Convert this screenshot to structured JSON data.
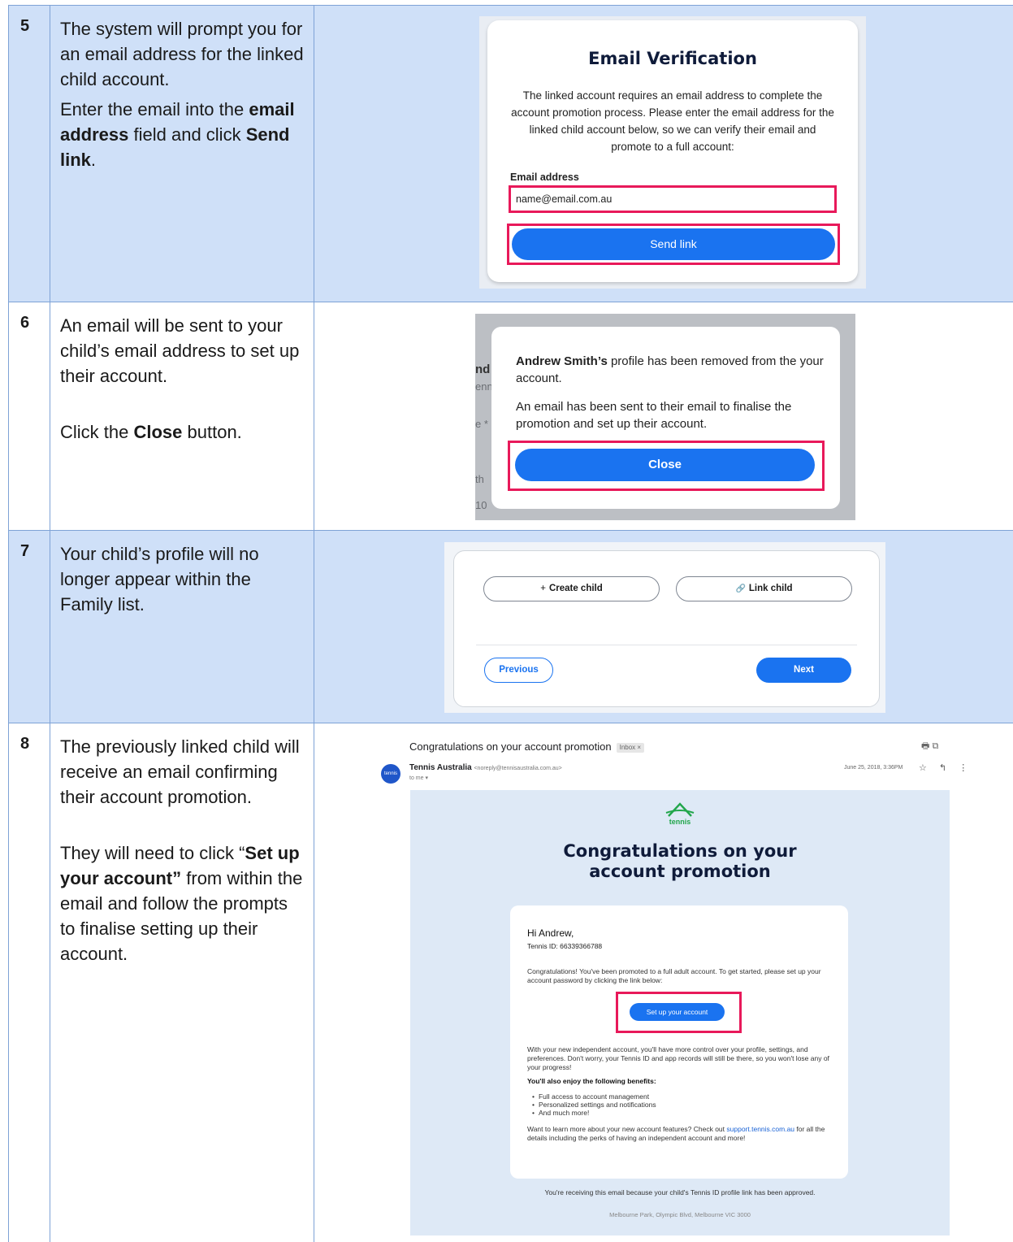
{
  "steps": [
    {
      "number": "5",
      "para1": "The system will prompt you for an email address for the linked child account.",
      "para2": {
        "pre": "Enter the email into the ",
        "bold1": "email address",
        "mid": " field and click ",
        "bold2": "Send link",
        "post": "."
      }
    },
    {
      "number": "6",
      "para1": "An email will be sent to your child’s email address to set up their account.",
      "para2": {
        "pre": "Click the ",
        "bold1": "Close",
        "post": " button."
      }
    },
    {
      "number": "7",
      "para1": "Your child’s profile will no longer appear within the Family list."
    },
    {
      "number": "8",
      "para1": "The previously linked child will receive an email confirming their account promotion.",
      "para2": {
        "pre": "They will need to click “",
        "bold1": "Set up your account”",
        "post": " from within the email and follow the prompts to finalise setting up their account."
      }
    }
  ],
  "verification": {
    "title": "Email Verification",
    "body": "The linked account requires an email address to complete the account promotion process. Please enter the email address for the linked child account below, so we can verify their email and promote to a full account:",
    "field_label": "Email address",
    "field_value": "name@email.com.au",
    "send_label": "Send link"
  },
  "removed_modal": {
    "name": "Andrew Smith’s",
    "line1_rest": " profile has been removed from the your account.",
    "line2": "An email has been sent to their email to finalise the promotion and set up their account.",
    "close_label": "Close",
    "ghost": {
      "a": "nd",
      "b": "enn",
      "c": "e *",
      "d": "th",
      "e": "10"
    }
  },
  "family": {
    "create_icon": "+",
    "create_label": "Create child",
    "link_icon": "🔗",
    "link_label": "Link child",
    "previous_label": "Previous",
    "next_label": "Next"
  },
  "email": {
    "subject": "Congratulations on your account promotion",
    "badge": "Inbox ×",
    "tools": "🖶  ⧉",
    "sender_name": "Tennis Australia",
    "sender_addr": "<noreply@tennisaustralia.com.au>",
    "to_me": "to me ▾",
    "date": "June 25, 2018, 3:36PM",
    "actions": "☆ ↰ ⋮",
    "avatar_text": "tennis",
    "logo_word": "tennis",
    "headline_line1": "Congratulations on your",
    "headline_line2": "account promotion",
    "greeting": "Hi Andrew,",
    "tennis_id": "Tennis ID: 66339366788",
    "p1": "Congratulations! You've been promoted to a full adult account. To get started, please set up your account password by clicking the link below:",
    "button": "Set up your account",
    "p2": "With your new independent account, you'll have more control over your profile, settings, and preferences. Don't worry, your Tennis ID and app records will still be there, so you won't lose any of your progress!",
    "benefits_heading": "You'll also enjoy the following benefits:",
    "benefits": [
      "Full access to account management",
      "Personalized settings and notifications",
      "And much more!"
    ],
    "p3_pre": "Want to learn more about your new account features? Check out ",
    "p3_link": "support.tennis.com.au",
    "p3_post": " for all the details including the perks of having an independent account and more!",
    "footer1": "You're receiving this email because your child's Tennis ID profile link has been approved.",
    "footer2": "Melbourne Park, Olympic Blvd, Melbourne VIC 3000"
  },
  "colors": {
    "accent_blue": "#1a73f0",
    "highlight_pink": "#e8195a",
    "row_blue": "#cfe0f8",
    "grid_line": "#7ea2d6"
  }
}
